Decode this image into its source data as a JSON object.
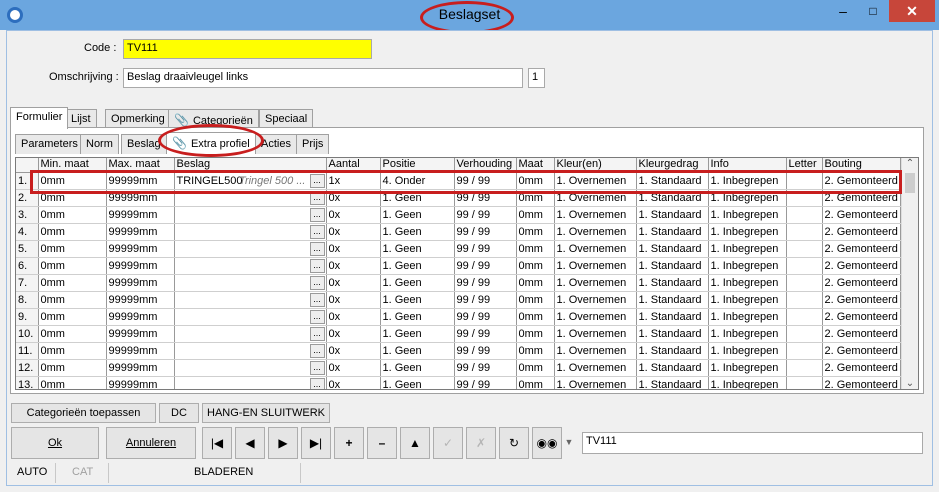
{
  "window": {
    "title": "Beslagset"
  },
  "form": {
    "code_label": "Code :",
    "code_value": "TV111",
    "omschrijving_label": "Omschrijving :",
    "omschrijving_value": "Beslag draaivleugel links",
    "count": "1"
  },
  "tabs_main": [
    "Formulier",
    "Lijst",
    "Opmerking",
    "Categorieën",
    "Speciaal"
  ],
  "tabs_sub": [
    "Parameters",
    "Norm",
    "Beslag",
    "Extra profiel",
    "Acties",
    "Prijs"
  ],
  "grid": {
    "columns": [
      "Min. maat",
      "Max. maat",
      "Beslag",
      "Aantal",
      "Positie",
      "Verhouding",
      "Maat",
      "Kleur(en)",
      "Kleurgedrag",
      "Info",
      "Letter",
      "Bouting"
    ],
    "rows": [
      [
        "1.",
        "0mm",
        "99999mm",
        "TRINGEL500",
        "Tringel 500 ...",
        "1x",
        "4. Onder",
        "99 / 99",
        "0mm",
        "1. Overnemen",
        "1. Standaard",
        "1. Inbegrepen",
        "",
        "2. Gemonteerd"
      ],
      [
        "2.",
        "0mm",
        "99999mm",
        "",
        "",
        "0x",
        "1. Geen",
        "99 / 99",
        "0mm",
        "1. Overnemen",
        "1. Standaard",
        "1. Inbegrepen",
        "",
        "2. Gemonteerd"
      ],
      [
        "3.",
        "0mm",
        "99999mm",
        "",
        "",
        "0x",
        "1. Geen",
        "99 / 99",
        "0mm",
        "1. Overnemen",
        "1. Standaard",
        "1. Inbegrepen",
        "",
        "2. Gemonteerd"
      ],
      [
        "4.",
        "0mm",
        "99999mm",
        "",
        "",
        "0x",
        "1. Geen",
        "99 / 99",
        "0mm",
        "1. Overnemen",
        "1. Standaard",
        "1. Inbegrepen",
        "",
        "2. Gemonteerd"
      ],
      [
        "5.",
        "0mm",
        "99999mm",
        "",
        "",
        "0x",
        "1. Geen",
        "99 / 99",
        "0mm",
        "1. Overnemen",
        "1. Standaard",
        "1. Inbegrepen",
        "",
        "2. Gemonteerd"
      ],
      [
        "6.",
        "0mm",
        "99999mm",
        "",
        "",
        "0x",
        "1. Geen",
        "99 / 99",
        "0mm",
        "1. Overnemen",
        "1. Standaard",
        "1. Inbegrepen",
        "",
        "2. Gemonteerd"
      ],
      [
        "7.",
        "0mm",
        "99999mm",
        "",
        "",
        "0x",
        "1. Geen",
        "99 / 99",
        "0mm",
        "1. Overnemen",
        "1. Standaard",
        "1. Inbegrepen",
        "",
        "2. Gemonteerd"
      ],
      [
        "8.",
        "0mm",
        "99999mm",
        "",
        "",
        "0x",
        "1. Geen",
        "99 / 99",
        "0mm",
        "1. Overnemen",
        "1. Standaard",
        "1. Inbegrepen",
        "",
        "2. Gemonteerd"
      ],
      [
        "9.",
        "0mm",
        "99999mm",
        "",
        "",
        "0x",
        "1. Geen",
        "99 / 99",
        "0mm",
        "1. Overnemen",
        "1. Standaard",
        "1. Inbegrepen",
        "",
        "2. Gemonteerd"
      ],
      [
        "10.",
        "0mm",
        "99999mm",
        "",
        "",
        "0x",
        "1. Geen",
        "99 / 99",
        "0mm",
        "1. Overnemen",
        "1. Standaard",
        "1. Inbegrepen",
        "",
        "2. Gemonteerd"
      ],
      [
        "11.",
        "0mm",
        "99999mm",
        "",
        "",
        "0x",
        "1. Geen",
        "99 / 99",
        "0mm",
        "1. Overnemen",
        "1. Standaard",
        "1. Inbegrepen",
        "",
        "2. Gemonteerd"
      ],
      [
        "12.",
        "0mm",
        "99999mm",
        "",
        "",
        "0x",
        "1. Geen",
        "99 / 99",
        "0mm",
        "1. Overnemen",
        "1. Standaard",
        "1. Inbegrepen",
        "",
        "2. Gemonteerd"
      ],
      [
        "13.",
        "0mm",
        "99999mm",
        "",
        "",
        "0x",
        "1. Geen",
        "99 / 99",
        "0mm",
        "1. Overnemen",
        "1. Standaard",
        "1. Inbegrepen",
        "",
        "2. Gemonteerd"
      ]
    ]
  },
  "actions": {
    "apply_categories": "Categorieën toepassen",
    "dc": "DC",
    "hang_sluitwerk": "HANG-EN SLUITWERK",
    "ok": "Ok",
    "cancel": "Annuleren",
    "search_value": "TV111"
  },
  "nav_icons": [
    "first-icon",
    "prev-icon",
    "next-icon",
    "last-icon",
    "add-icon",
    "remove-icon",
    "up-icon",
    "confirm-icon",
    "cancel-edit-icon",
    "refresh-icon",
    "binoculars-icon"
  ],
  "status": {
    "mode1": "AUTO",
    "mode2": "CAT",
    "mode3": "BLADEREN"
  },
  "colors": {
    "titlebar": "#6ba6df",
    "code_highlight": "#ffff00",
    "annotation": "#c81e1e"
  }
}
